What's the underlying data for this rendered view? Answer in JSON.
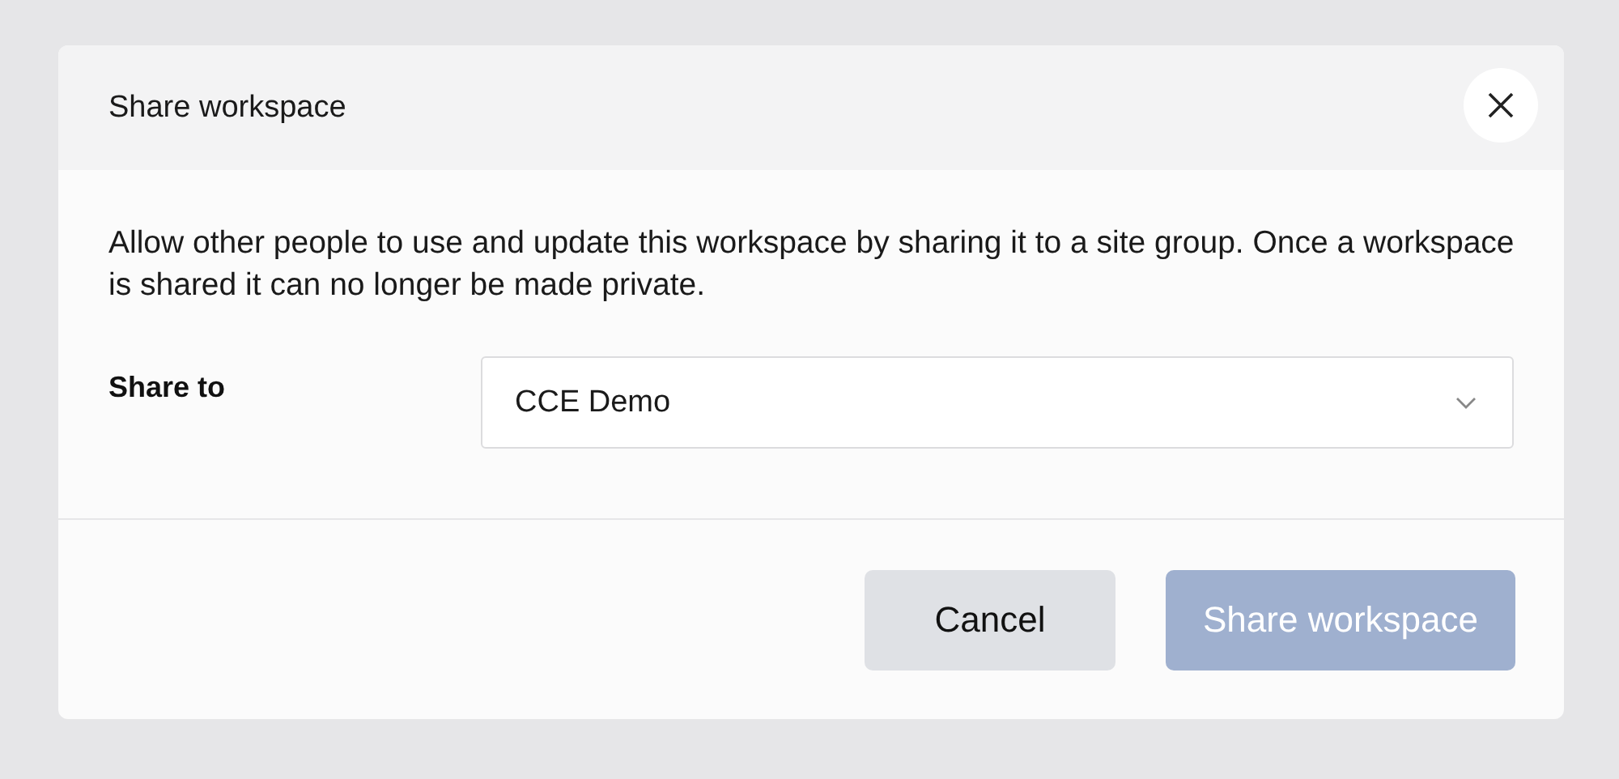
{
  "dialog": {
    "title": "Share workspace",
    "description": "Allow other people to use and update this workspace by sharing it to a site group. Once a workspace is shared it can no longer be made private.",
    "field": {
      "label": "Share to",
      "value": "CCE Demo"
    },
    "buttons": [
      {
        "label": "Cancel",
        "kind": "secondary",
        "disabled": false
      },
      {
        "label": "Share workspace",
        "kind": "primary",
        "disabled": true
      }
    ]
  }
}
